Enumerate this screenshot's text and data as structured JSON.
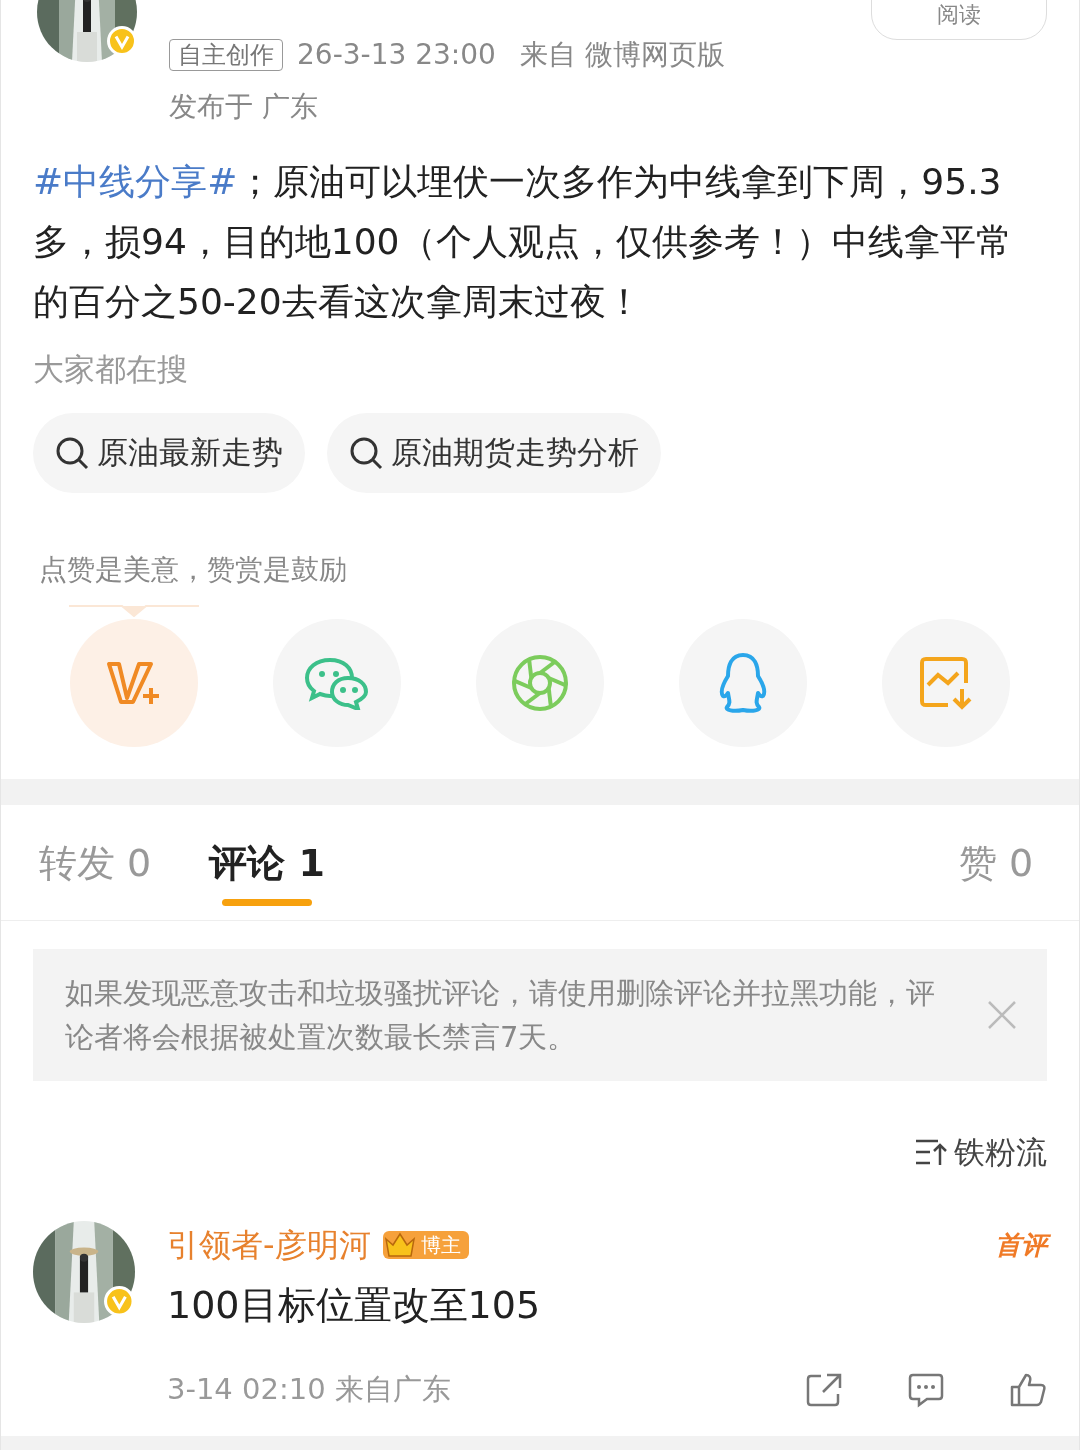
{
  "post": {
    "read_label": "阅读",
    "badge": "自主创作",
    "time": "26-3-13 23:00",
    "source": "来自 微博网页版",
    "location": "发布于 广东",
    "body": [
      {
        "kind": "hashtag",
        "text": "#中线分享#"
      },
      {
        "kind": "plain",
        "text": "；原油可以埋伏一次多作为中线拿到下周，95.3多，损94，目的地100（个人观点，仅供参考！）中线拿平常的百分之50-20去看这次拿周末过夜！"
      }
    ]
  },
  "searches": {
    "title": "大家都在搜",
    "items": [
      "原油最新走势",
      "原油期货走势分析"
    ]
  },
  "reward": {
    "hint": "点赞是美意，赞赏是鼓励",
    "actions": [
      {
        "kind": "reward",
        "selected": true
      },
      {
        "kind": "wechat",
        "selected": false
      },
      {
        "kind": "moments",
        "selected": false
      },
      {
        "kind": "qq",
        "selected": false
      },
      {
        "kind": "save",
        "selected": false
      }
    ]
  },
  "tabs": [
    {
      "label": "转发 0",
      "selected": false
    },
    {
      "label": "评论 1",
      "selected": true
    },
    {
      "label": "赞 0",
      "selected": false
    }
  ],
  "notice": {
    "text": "如果发现恶意攻击和垃圾骚扰评论，请使用删除评论并拉黑功能，评论者将会根据被处置次数最长禁言7天。"
  },
  "sort": "铁粉流",
  "comments": [
    {
      "author": "引领者-彦明河",
      "role": "博主",
      "first_label": "首评",
      "text": "100目标位置改至105",
      "meta": "3-14 02:10 来自广东"
    }
  ]
}
